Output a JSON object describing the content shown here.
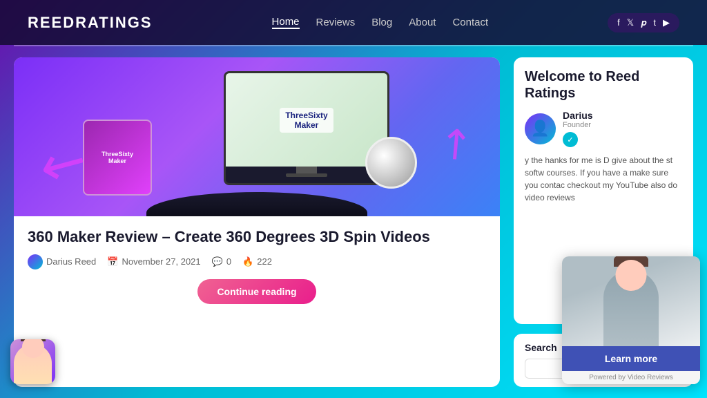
{
  "header": {
    "logo": "ReedRatings",
    "nav": {
      "home": "Home",
      "reviews": "Reviews",
      "blog": "Blog",
      "about": "About",
      "contact": "Contact"
    },
    "social": [
      "f",
      "t",
      "p",
      "t",
      "y"
    ]
  },
  "article": {
    "title": "360 Maker Review – Create 360 Degrees 3D Spin Videos",
    "author": "Darius Reed",
    "date": "November 27, 2021",
    "comments": "0",
    "views": "222",
    "continue_btn": "Continue reading"
  },
  "sidebar": {
    "welcome_title": "Welcome to Reed Ratings",
    "author_name": "Darius",
    "author_role": "Founder",
    "welcome_text": "y the   hanks for   me is D   give   about the   st softw   courses. If you have a   make sure you contac   checkout my YouTube   also do video reviews",
    "search_label": "Search",
    "search_placeholder": ""
  },
  "video_widget": {
    "learn_more": "Learn more",
    "powered_text": "Powered by Video Reviews"
  }
}
